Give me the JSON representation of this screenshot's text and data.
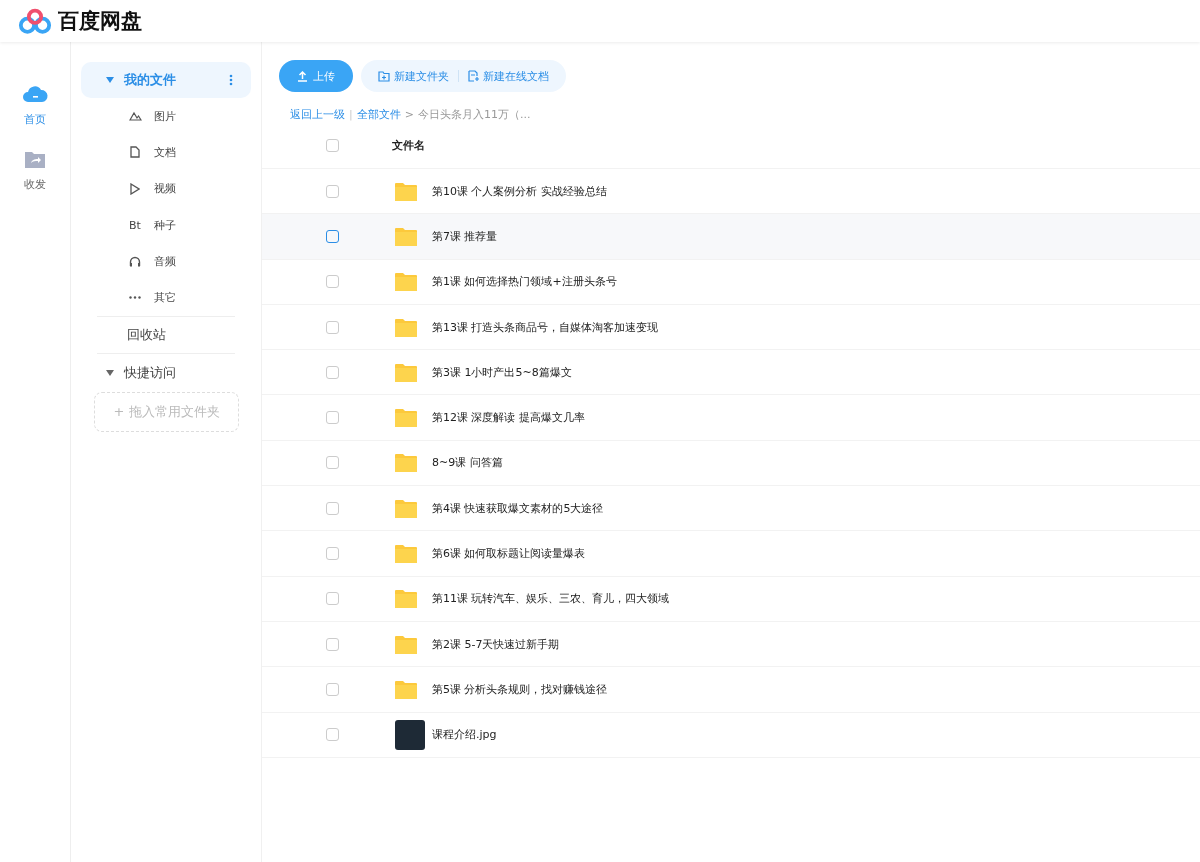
{
  "app": {
    "title": "百度网盘"
  },
  "rail": [
    {
      "label": "首页",
      "kind": "home",
      "selected": true
    },
    {
      "label": "收发",
      "kind": "share",
      "selected": false
    }
  ],
  "sidebar": {
    "my_files": {
      "label": "我的文件",
      "expanded": true,
      "selected": true
    },
    "categories": [
      {
        "label": "图片",
        "kind": "image"
      },
      {
        "label": "文档",
        "kind": "doc"
      },
      {
        "label": "视频",
        "kind": "video"
      },
      {
        "label": "种子",
        "kind": "bt",
        "icon_text": "Bt"
      },
      {
        "label": "音频",
        "kind": "audio"
      },
      {
        "label": "其它",
        "kind": "other"
      }
    ],
    "recycle": "回收站",
    "quick_access": {
      "label": "快捷访问",
      "expanded": true
    },
    "drop_zone": "+ 拖入常用文件夹"
  },
  "toolbar": {
    "upload": "上传",
    "new_folder": "新建文件夹",
    "new_doc": "新建在线文档"
  },
  "breadcrumb": {
    "back": "返回上一级",
    "separator": "|",
    "root": "全部文件",
    "arrow": ">",
    "current": "今日头条月入11万（..."
  },
  "table": {
    "select_all_checked": false,
    "columns": [
      "文件名"
    ],
    "rows": [
      {
        "name": "第10课 个人案例分析 实战经验总结",
        "kind": "folder",
        "hovered": false,
        "checked": false
      },
      {
        "name": "第7课 推荐量",
        "kind": "folder",
        "hovered": true,
        "checked": false
      },
      {
        "name": "第1课 如何选择热门领域+注册头条号",
        "kind": "folder",
        "hovered": false,
        "checked": false
      },
      {
        "name": "第13课 打造头条商品号，自媒体淘客加速变现",
        "kind": "folder",
        "hovered": false,
        "checked": false
      },
      {
        "name": "第3课 1小时产出5~8篇爆文",
        "kind": "folder",
        "hovered": false,
        "checked": false
      },
      {
        "name": "第12课 深度解读 提高爆文几率",
        "kind": "folder",
        "hovered": false,
        "checked": false
      },
      {
        "name": "8~9课 问答篇",
        "kind": "folder",
        "hovered": false,
        "checked": false
      },
      {
        "name": "第4课 快速获取爆文素材的5大途径",
        "kind": "folder",
        "hovered": false,
        "checked": false
      },
      {
        "name": "第6课 如何取标题让阅读量爆表",
        "kind": "folder",
        "hovered": false,
        "checked": false
      },
      {
        "name": "第11课 玩转汽车、娱乐、三农、育儿，四大领域",
        "kind": "folder",
        "hovered": false,
        "checked": false
      },
      {
        "name": "第2课 5-7天快速过新手期",
        "kind": "folder",
        "hovered": false,
        "checked": false
      },
      {
        "name": "第5课 分析头条规则，找对赚钱途径",
        "kind": "folder",
        "hovered": false,
        "checked": false
      },
      {
        "name": "课程介绍.jpg",
        "kind": "image",
        "hovered": false,
        "checked": false
      }
    ]
  }
}
